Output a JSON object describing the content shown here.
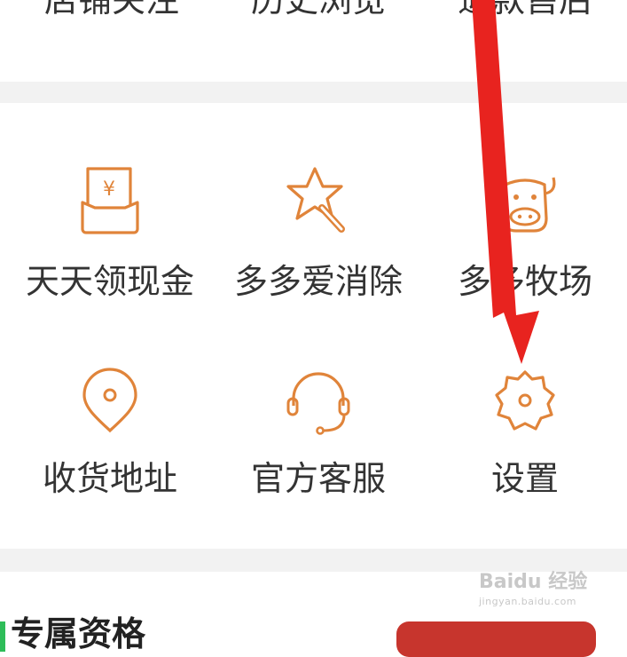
{
  "top_row": [
    {
      "label": "店铺关注"
    },
    {
      "label": "历史浏览"
    },
    {
      "label": "退款售后"
    }
  ],
  "grid": [
    {
      "label": "天天领现金",
      "icon": "cash-icon"
    },
    {
      "label": "多多爱消除",
      "icon": "star-wand-icon"
    },
    {
      "label": "多多牧场",
      "icon": "cow-icon"
    },
    {
      "label": "收货地址",
      "icon": "location-pin-icon"
    },
    {
      "label": "官方客服",
      "icon": "headset-icon"
    },
    {
      "label": "设置",
      "icon": "gear-icon"
    }
  ],
  "bottom": {
    "title": "专属资格"
  },
  "watermark": {
    "brand": "Baidu 经验",
    "url": "jingyan.baidu.com"
  },
  "colors": {
    "accent": "#e0843a",
    "arrow": "#e8231f",
    "text": "#333333"
  }
}
